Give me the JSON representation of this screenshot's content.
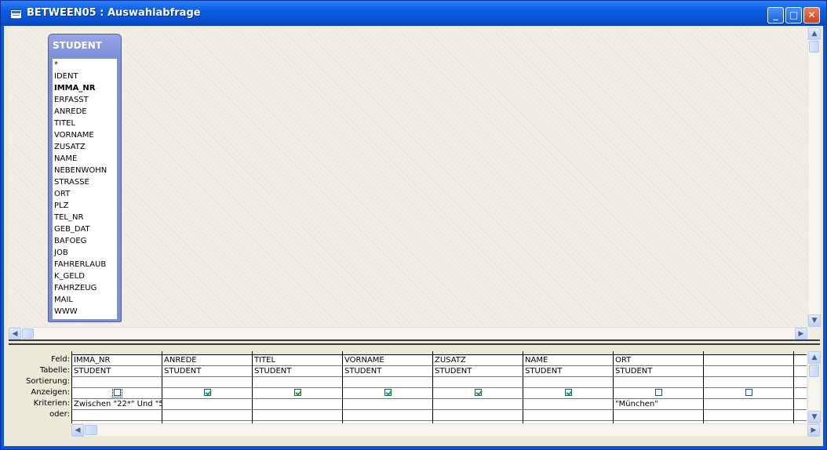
{
  "window": {
    "title": "BETWEEN05 : Auswahlabfrage",
    "buttons": {
      "minimize": "_",
      "maximize": "□",
      "close": "✕"
    }
  },
  "table": {
    "name": "STUDENT",
    "fields": [
      "*",
      "IDENT",
      "IMMA_NR",
      "ERFASST",
      "ANREDE",
      "TITEL",
      "VORNAME",
      "ZUSATZ",
      "NAME",
      "NEBENWOHN",
      "STRASSE",
      "ORT",
      "PLZ",
      "TEL_NR",
      "GEB_DAT",
      "BAFOEG",
      "JOB",
      "FAHRERLAUB",
      "K_GELD",
      "FAHRZEUG",
      "MAIL",
      "WWW"
    ],
    "primary_key_field": "IMMA_NR"
  },
  "grid": {
    "row_labels": [
      "Feld:",
      "Tabelle:",
      "Sortierung:",
      "Anzeigen:",
      "Kriterien:",
      "oder:"
    ],
    "columns": [
      {
        "field": "IMMA_NR",
        "table": "STUDENT",
        "sort": "",
        "show": false,
        "criteria": "Zwischen \"22*\" Und \"5.",
        "or": ""
      },
      {
        "field": "ANREDE",
        "table": "STUDENT",
        "sort": "",
        "show": true,
        "criteria": "",
        "or": ""
      },
      {
        "field": "TITEL",
        "table": "STUDENT",
        "sort": "",
        "show": true,
        "criteria": "",
        "or": ""
      },
      {
        "field": "VORNAME",
        "table": "STUDENT",
        "sort": "",
        "show": true,
        "criteria": "",
        "or": ""
      },
      {
        "field": "ZUSATZ",
        "table": "STUDENT",
        "sort": "",
        "show": true,
        "criteria": "",
        "or": ""
      },
      {
        "field": "NAME",
        "table": "STUDENT",
        "sort": "",
        "show": true,
        "criteria": "",
        "or": ""
      },
      {
        "field": "ORT",
        "table": "STUDENT",
        "sort": "",
        "show": false,
        "criteria": "\"München\"",
        "or": ""
      },
      {
        "field": "",
        "table": "",
        "sort": "",
        "show": false,
        "criteria": "",
        "or": ""
      },
      {
        "field": "",
        "table": "",
        "sort": "",
        "show": false,
        "criteria": "",
        "or": ""
      }
    ]
  },
  "scroll": {
    "up": "▲",
    "down": "▼",
    "left": "◀",
    "right": "▶"
  },
  "colors": {
    "titlebar": "#0A55D8",
    "table_header": "#7C8FD8",
    "check": "#21A121"
  }
}
